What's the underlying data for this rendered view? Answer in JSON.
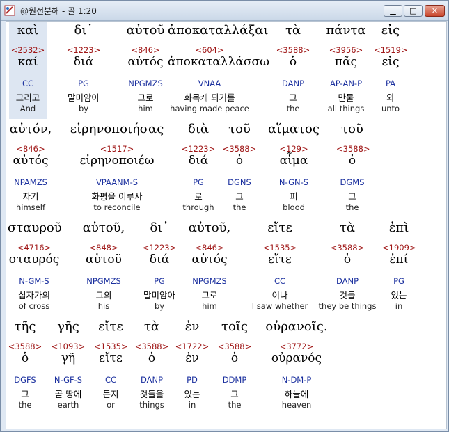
{
  "window": {
    "title": "@원전분해 - 골 1:20",
    "minimize_label": "▁",
    "maximize_label": "□",
    "close_label": "✕"
  },
  "colors": {
    "strong": "#a01818",
    "parsing": "#1a2f9e",
    "highlight": "#dde6f2"
  },
  "rows": [
    {
      "words": [
        {
          "greek": "καὶ",
          "strong": "<2532>",
          "lemma": "καί",
          "parsing": "CC",
          "korean": "그리고",
          "english": "And"
        },
        {
          "greek": "δι᾽",
          "strong": "<1223>",
          "lemma": "διά",
          "parsing": "PG",
          "korean": "말미암아",
          "english": "by"
        },
        {
          "greek": "αὐτοῦ",
          "strong": "<846>",
          "lemma": "αὐτός",
          "parsing": "NPGMZS",
          "korean": "그로",
          "english": "him"
        },
        {
          "greek": "ἀποκαταλλάξαι",
          "strong": "<604>",
          "lemma": "ἀποκαταλλάσσω",
          "parsing": "VNAA",
          "korean": "화목케 되기를",
          "english": "having made peace"
        },
        {
          "greek": "τὰ",
          "strong": "<3588>",
          "lemma": "ὁ",
          "parsing": "DANP",
          "korean": "그",
          "english": "the"
        },
        {
          "greek": "πάντα",
          "strong": "<3956>",
          "lemma": "πᾶς",
          "parsing": "AP-AN-P",
          "korean": "만물",
          "english": "all things"
        },
        {
          "greek": "εἰς",
          "strong": "<1519>",
          "lemma": "εἰς",
          "parsing": "PA",
          "korean": "와",
          "english": "unto"
        }
      ]
    },
    {
      "words": [
        {
          "greek": "αὐτόν,",
          "strong": "<846>",
          "lemma": "αὐτός",
          "parsing": "NPAMZS",
          "korean": "자기",
          "english": "himself"
        },
        {
          "greek": "εἰρηνοποιήσας",
          "strong": "<1517>",
          "lemma": "εἰρηνοποιέω",
          "parsing": "VPAANM-S",
          "korean": "화평을 이루사",
          "english": "to reconcile"
        },
        {
          "greek": "διὰ",
          "strong": "<1223>",
          "lemma": "διά",
          "parsing": "PG",
          "korean": "로",
          "english": "through"
        },
        {
          "greek": "τοῦ",
          "strong": "<3588>",
          "lemma": "ὁ",
          "parsing": "DGNS",
          "korean": "그",
          "english": "the"
        },
        {
          "greek": "αἵματος",
          "strong": "<129>",
          "lemma": "αἷμα",
          "parsing": "N-GN-S",
          "korean": "피",
          "english": "blood"
        },
        {
          "greek": "τοῦ",
          "strong": "<3588>",
          "lemma": "ὁ",
          "parsing": "DGMS",
          "korean": "그",
          "english": "the"
        }
      ]
    },
    {
      "words": [
        {
          "greek": "σταυροῦ",
          "strong": "<4716>",
          "lemma": "σταυρός",
          "parsing": "N-GM-S",
          "korean": "십자가의",
          "english": "of cross"
        },
        {
          "greek": "αὐτοῦ,",
          "strong": "<848>",
          "lemma": "αὑτοῦ",
          "parsing": "NPGMZS",
          "korean": "그의",
          "english": "his"
        },
        {
          "greek": "δι᾽",
          "strong": "<1223>",
          "lemma": "διά",
          "parsing": "PG",
          "korean": "말미암아",
          "english": "by"
        },
        {
          "greek": "αὐτοῦ,",
          "strong": "<846>",
          "lemma": "αὐτός",
          "parsing": "NPGMZS",
          "korean": "그로",
          "english": "him"
        },
        {
          "greek": "εἴτε",
          "strong": "<1535>",
          "lemma": "εἴτε",
          "parsing": "CC",
          "korean": "이나",
          "english": "I saw whether"
        },
        {
          "greek": "τὰ",
          "strong": "<3588>",
          "lemma": "ὁ",
          "parsing": "DANP",
          "korean": "것들",
          "english": "they be things"
        },
        {
          "greek": "ἐπὶ",
          "strong": "<1909>",
          "lemma": "ἐπί",
          "parsing": "PG",
          "korean": "있는",
          "english": "in"
        }
      ]
    },
    {
      "words": [
        {
          "greek": "τῆς",
          "strong": "<3588>",
          "lemma": "ὁ",
          "parsing": "DGFS",
          "korean": "그",
          "english": "the"
        },
        {
          "greek": "γῆς",
          "strong": "<1093>",
          "lemma": "γῆ",
          "parsing": "N-GF-S",
          "korean": "곧 땅에",
          "english": "earth"
        },
        {
          "greek": "εἴτε",
          "strong": "<1535>",
          "lemma": "εἴτε",
          "parsing": "CC",
          "korean": "든지",
          "english": "or"
        },
        {
          "greek": "τὰ",
          "strong": "<3588>",
          "lemma": "ὁ",
          "parsing": "DANP",
          "korean": "것들을",
          "english": "things"
        },
        {
          "greek": "ἐν",
          "strong": "<1722>",
          "lemma": "ἐν",
          "parsing": "PD",
          "korean": "있는",
          "english": "in"
        },
        {
          "greek": "τοῖς",
          "strong": "<3588>",
          "lemma": "ὁ",
          "parsing": "DDMP",
          "korean": "그",
          "english": "the"
        },
        {
          "greek": "οὐρανοῖς.",
          "strong": "<3772>",
          "lemma": "οὐρανός",
          "parsing": "N-DM-P",
          "korean": "하늘에",
          "english": "heaven"
        }
      ]
    }
  ]
}
